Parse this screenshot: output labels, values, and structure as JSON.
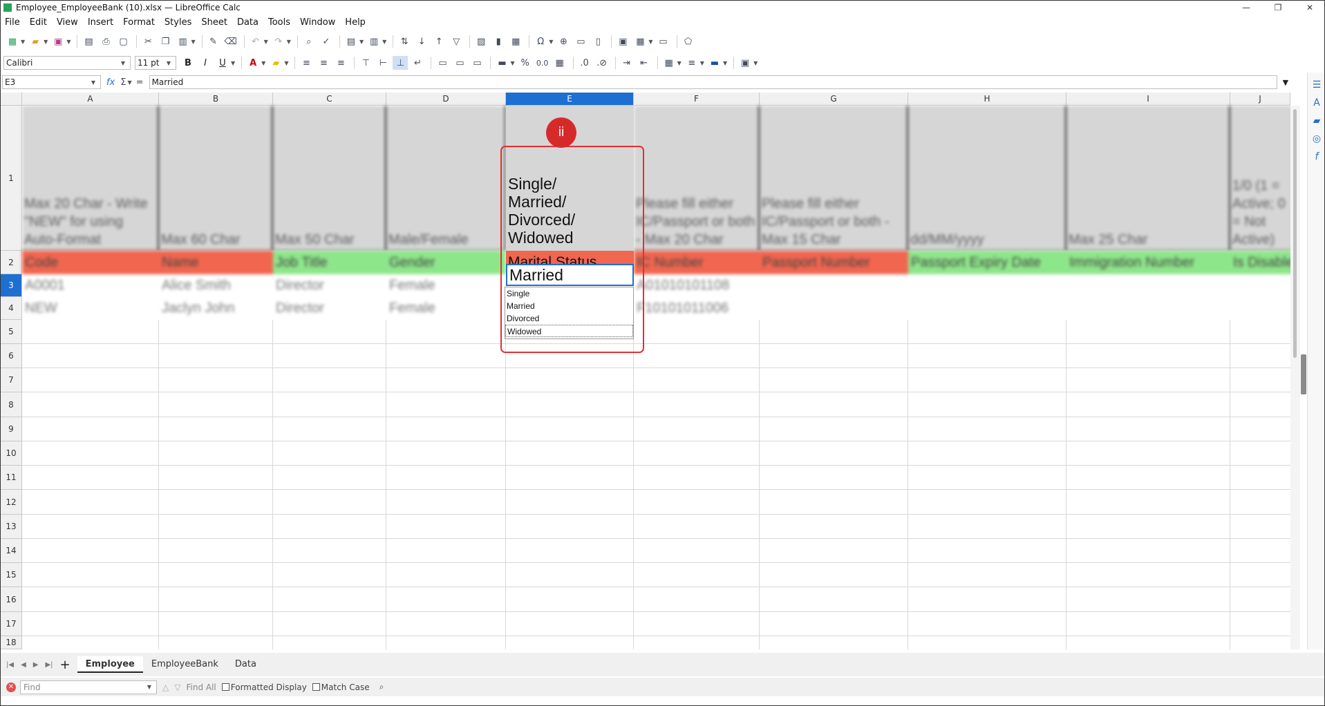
{
  "window": {
    "title": "Employee_EmployeeBank (10).xlsx — LibreOffice Calc",
    "controls": [
      "—",
      "❐",
      "✕"
    ]
  },
  "menu": [
    "File",
    "Edit",
    "View",
    "Insert",
    "Format",
    "Styles",
    "Sheet",
    "Data",
    "Tools",
    "Window",
    "Help"
  ],
  "toolbar": {
    "font_name": "Calibri",
    "font_size": "11 pt",
    "bold": "B",
    "italic": "I",
    "underline": "U",
    "percent": "%",
    "number_format": "0.0"
  },
  "formula_bar": {
    "cell_ref": "E3",
    "fx": "fx",
    "sigma": "Σ",
    "equals": "=",
    "content": "Married"
  },
  "columns": [
    "A",
    "B",
    "C",
    "D",
    "E",
    "F",
    "G",
    "H",
    "I",
    "J"
  ],
  "rows": [
    "1",
    "2",
    "3",
    "4",
    "5",
    "6",
    "7",
    "8",
    "9",
    "10",
    "11",
    "12",
    "13",
    "14",
    "15",
    "16",
    "17",
    "18"
  ],
  "row1_hints": {
    "A": "Max 20 Char - Write \"NEW\" for using Auto-Format",
    "B": "Max 60 Char",
    "C": "Max 50 Char",
    "D": "Male/Female",
    "E": "Single/ Married/ Divorced/ Widowed",
    "F": "Please fill either IC/Passport or both - Max 20 Char",
    "G": "Please fill either IC/Passport or both - Max 15 Char",
    "H": "dd/MM/yyyy",
    "I": "Max 25 Char",
    "J": "1/0 (1 = Active; 0 = Not Active)"
  },
  "row2_headers": {
    "A": "Code",
    "B": "Name",
    "C": "Job Title",
    "D": "Gender",
    "E": "Marital Status",
    "F": "IC Number",
    "G": "Passport Number",
    "H": "Passport Expiry Date",
    "I": "Immigration Number",
    "J": "Is Disabled"
  },
  "data_rows": [
    {
      "A": "A0001",
      "B": "Alice Smith",
      "C": "Director",
      "D": "Female",
      "E": "Married",
      "F": "A01010101108"
    },
    {
      "A": "NEW",
      "B": "Jaclyn John",
      "C": "Director",
      "D": "Female",
      "F": "F10101011006"
    }
  ],
  "dropdown": {
    "options": [
      "Single",
      "Married",
      "Divorced",
      "Widowed"
    ],
    "focused": "Widowed"
  },
  "annotation": {
    "badge": "ii",
    "color": "#d62a2a"
  },
  "sheet_tabs": {
    "tabs": [
      "Employee",
      "EmployeeBank",
      "Data"
    ],
    "active": "Employee"
  },
  "find_bar": {
    "placeholder": "Find",
    "find_all": "Find All",
    "formatted_display": "Formatted Display",
    "match_case": "Match Case"
  },
  "colors": {
    "selection": "#1d6fd1",
    "required_header": "#f0664f",
    "optional_header": "#8ee68a"
  }
}
